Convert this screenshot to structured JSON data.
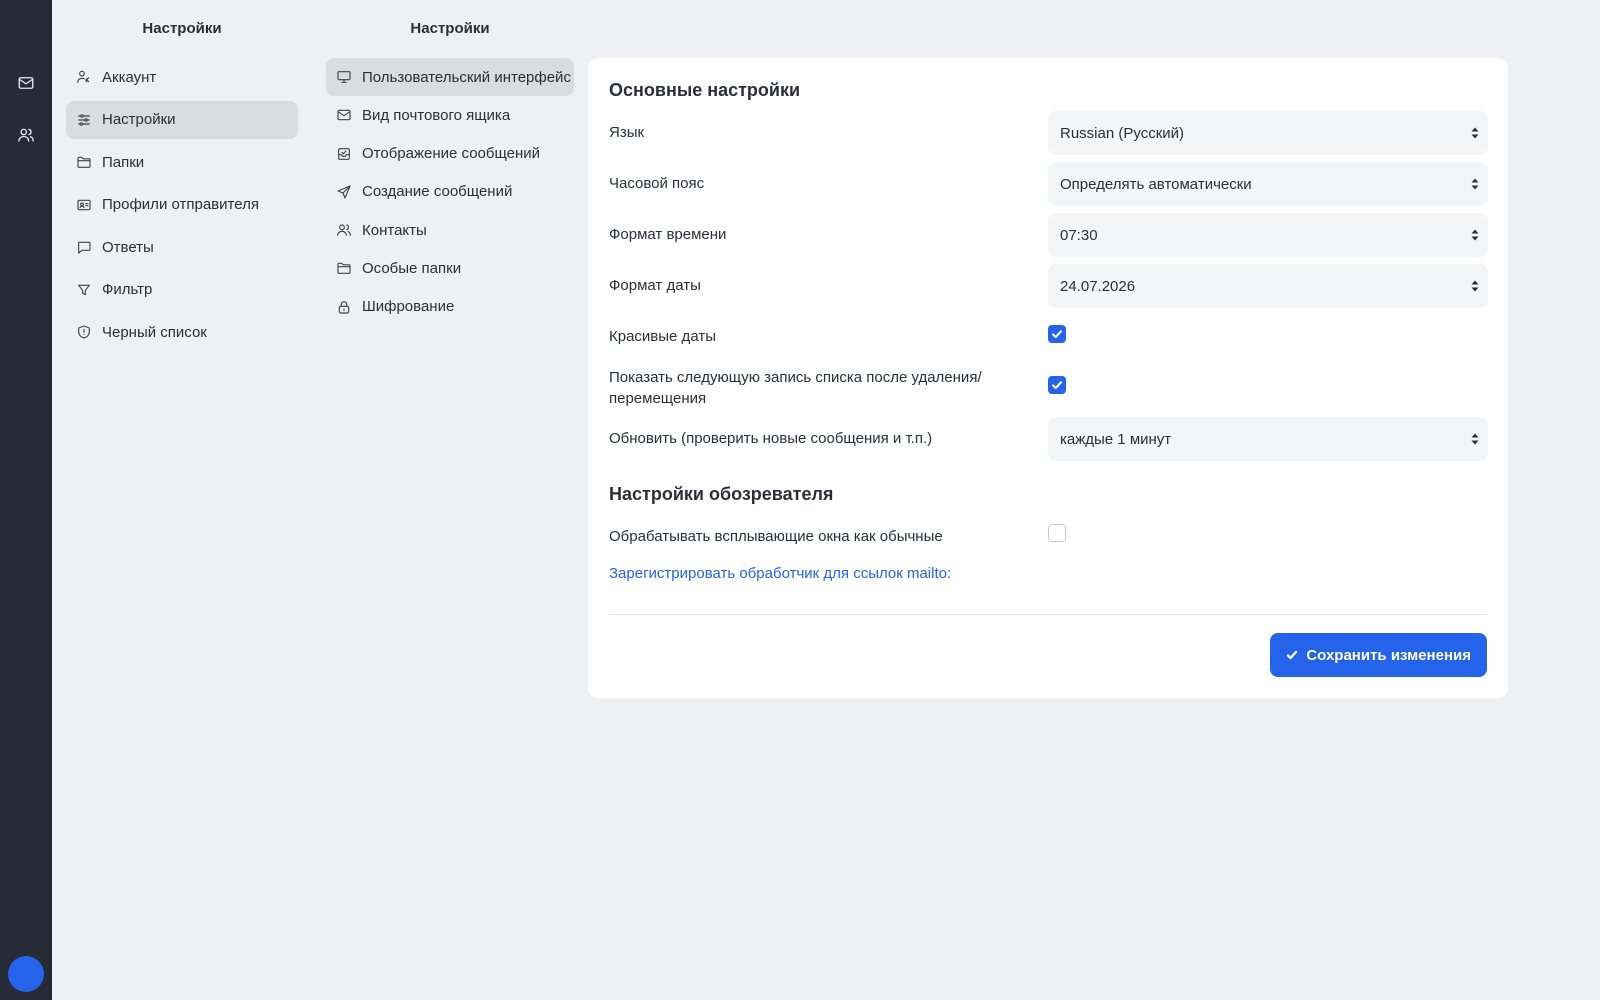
{
  "rail": {
    "icons": [
      "mail-icon",
      "contacts-icon"
    ]
  },
  "settings_nav": {
    "title": "Настройки",
    "items": [
      {
        "label": "Аккаунт",
        "icon": "user-key-icon"
      },
      {
        "label": "Настройки",
        "icon": "sliders-icon",
        "active": true
      },
      {
        "label": "Папки",
        "icon": "folder-icon"
      },
      {
        "label": "Профили отправителя",
        "icon": "id-card-icon"
      },
      {
        "label": "Ответы",
        "icon": "message-icon"
      },
      {
        "label": "Фильтр",
        "icon": "filter-icon"
      },
      {
        "label": "Черный список",
        "icon": "shield-icon"
      }
    ]
  },
  "prefs_nav": {
    "title": "Настройки",
    "items": [
      {
        "label": "Пользовательский интерфейс",
        "icon": "monitor-icon",
        "active": true
      },
      {
        "label": "Вид почтового ящика",
        "icon": "mail-icon"
      },
      {
        "label": "Отображение сообщений",
        "icon": "inbox-icon"
      },
      {
        "label": "Создание сообщений",
        "icon": "send-icon"
      },
      {
        "label": "Контакты",
        "icon": "contacts-icon"
      },
      {
        "label": "Особые папки",
        "icon": "folder-icon"
      },
      {
        "label": "Шифрование",
        "icon": "lock-icon"
      }
    ]
  },
  "main": {
    "section_basic": "Основные настройки",
    "language_label": "Язык",
    "language_value": "Russian (Русский)",
    "timezone_label": "Часовой пояс",
    "timezone_value": "Определять автоматически",
    "time_format_label": "Формат времени",
    "time_format_value": "07:30",
    "date_format_label": "Формат даты",
    "date_format_value": "24.07.2026",
    "pretty_dates_label": "Красивые даты",
    "pretty_dates_checked": true,
    "next_entry_label": "Показать следующую запись списка после удаления/перемещения",
    "next_entry_checked": true,
    "refresh_label": "Обновить (проверить новые сообщения и т.п.)",
    "refresh_value": "каждые 1 минут",
    "section_browser": "Настройки обозревателя",
    "popups_label": "Обрабатывать всплывающие окна как обычные",
    "popups_checked": false,
    "mailto_link": "Зарегистрировать обработчик для ссылок mailto:",
    "save_label": "Сохранить изменения"
  },
  "colors": {
    "accent": "#2563eb",
    "rail": "#262b36",
    "background": "#eef0f3",
    "active_item": "#d9dce1"
  }
}
